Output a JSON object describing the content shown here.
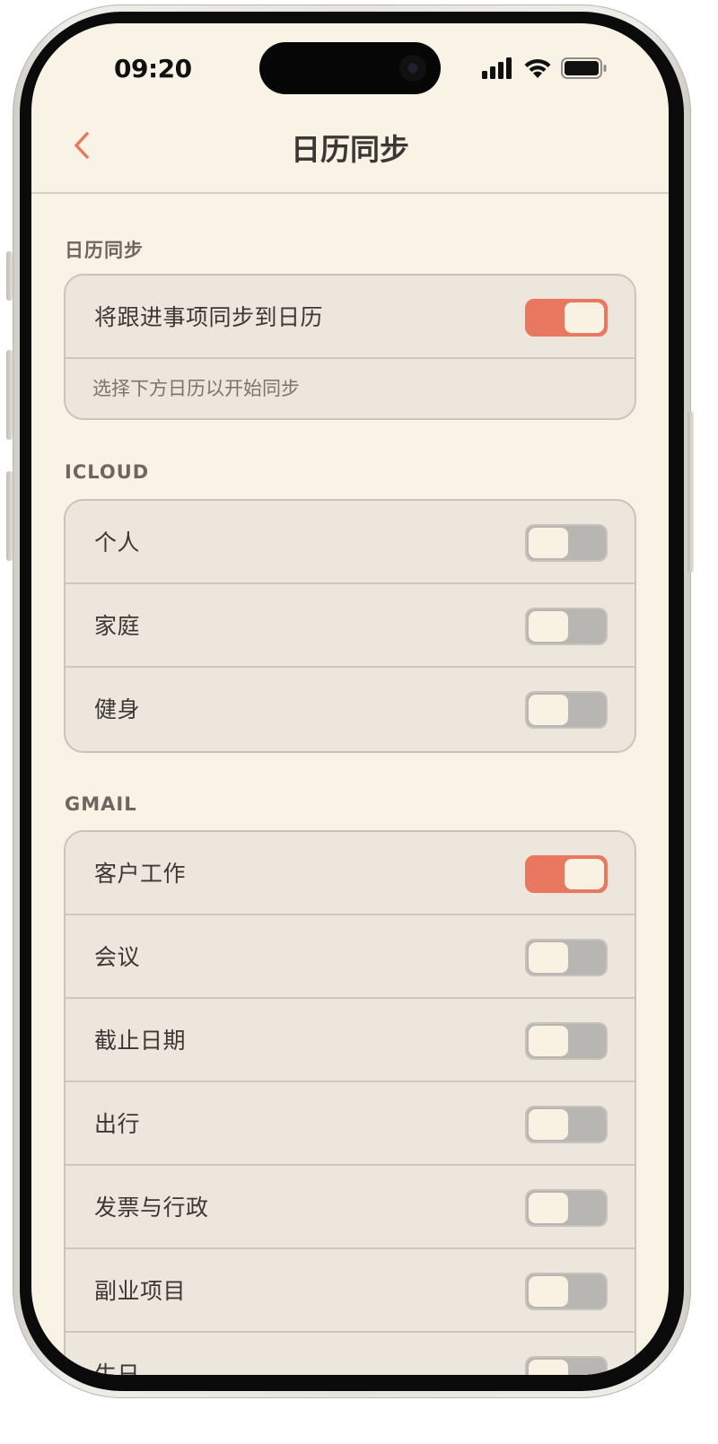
{
  "status_bar": {
    "time": "09:20"
  },
  "nav": {
    "title": "日历同步",
    "back_icon": "chevron-left-icon"
  },
  "colors": {
    "accent": "#e8785f",
    "background": "#f9f3e5",
    "card": "#ede6dc",
    "toggle_off": "#b8b6b3"
  },
  "sync": {
    "header": "日历同步",
    "main_label": "将跟进事项同步到日历",
    "main_on": true,
    "hint": "选择下方日历以开始同步"
  },
  "icloud": {
    "header": "ICLOUD",
    "items": [
      {
        "label": "个人",
        "on": false
      },
      {
        "label": "家庭",
        "on": false
      },
      {
        "label": "健身",
        "on": false
      }
    ]
  },
  "gmail": {
    "header": "GMAIL",
    "items": [
      {
        "label": "客户工作",
        "on": true
      },
      {
        "label": "会议",
        "on": false
      },
      {
        "label": "截止日期",
        "on": false
      },
      {
        "label": "出行",
        "on": false
      },
      {
        "label": "发票与行政",
        "on": false
      },
      {
        "label": "副业项目",
        "on": false
      },
      {
        "label": "生日",
        "on": false
      }
    ]
  }
}
